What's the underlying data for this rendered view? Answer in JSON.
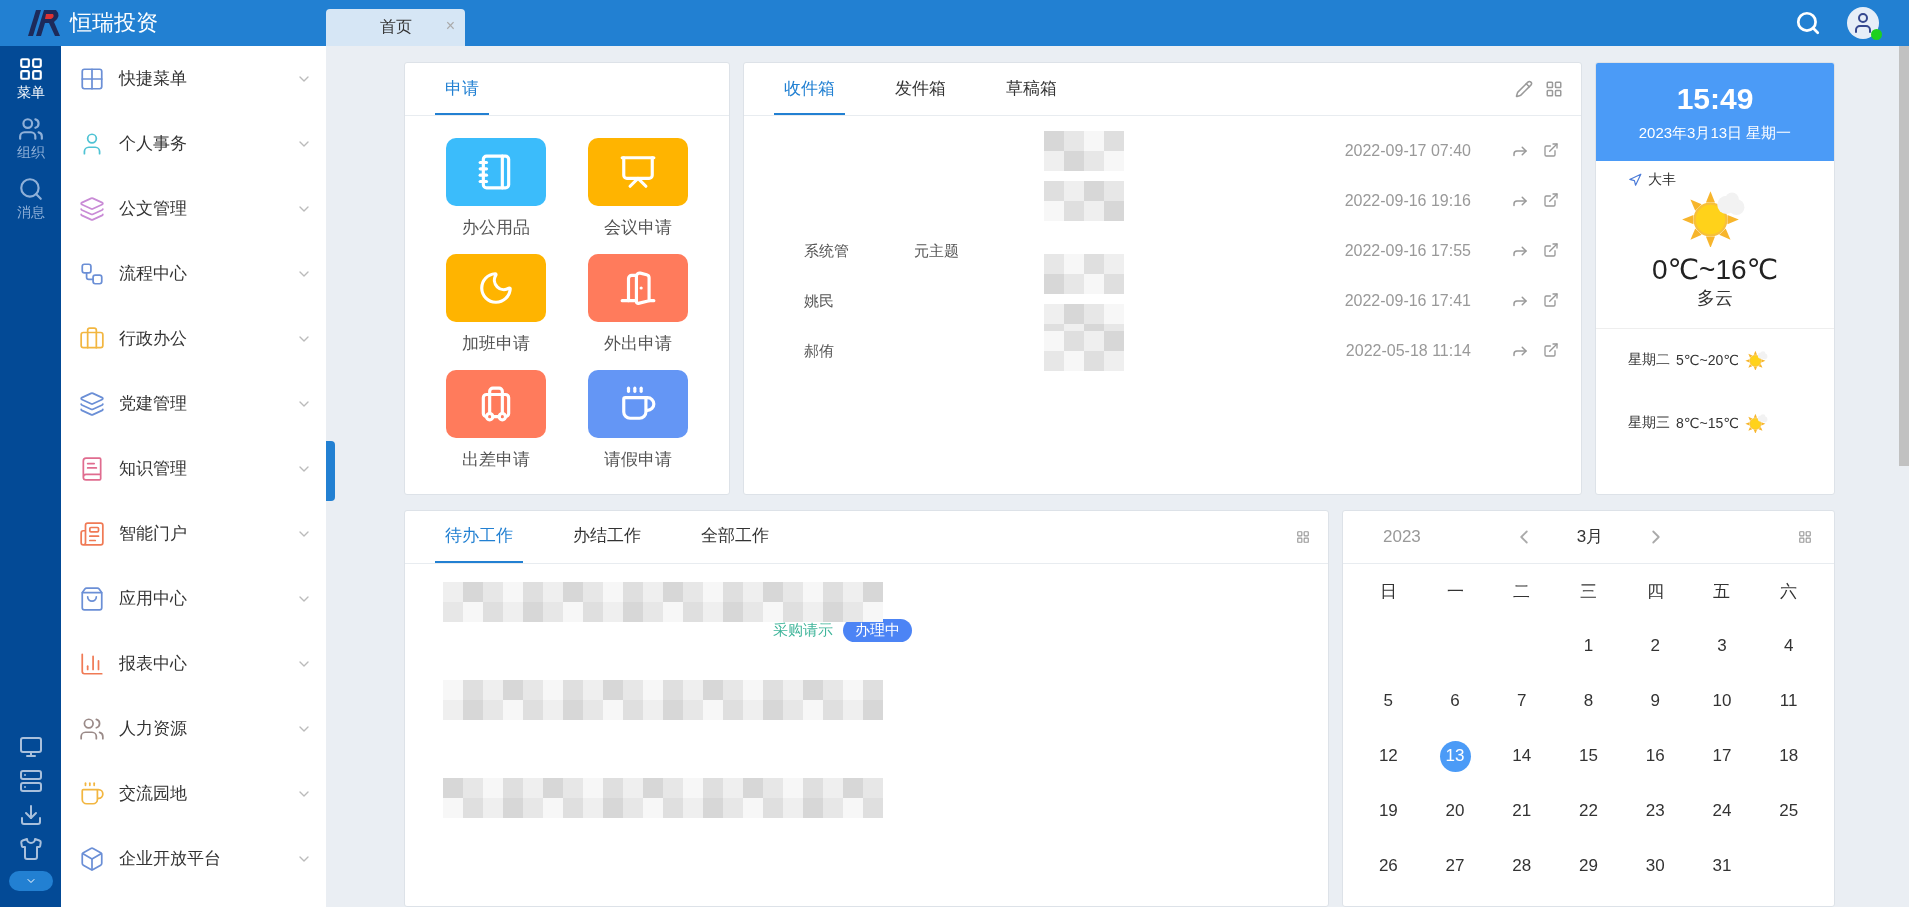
{
  "header": {
    "brand": "恒瑞投资"
  },
  "tabs": [
    {
      "label": "首页",
      "close": "×",
      "selected": true
    }
  ],
  "rail": [
    {
      "label": "菜单",
      "selected": true
    },
    {
      "label": "组织",
      "selected": false
    },
    {
      "label": "消息",
      "selected": false
    }
  ],
  "sidebar": [
    {
      "label": "快捷菜单",
      "color": "#6b8fd6"
    },
    {
      "label": "个人事务",
      "color": "#4fc3d4"
    },
    {
      "label": "公文管理",
      "color": "#c98bd6"
    },
    {
      "label": "流程中心",
      "color": "#6b8fd6"
    },
    {
      "label": "行政办公",
      "color": "#f2b640"
    },
    {
      "label": "党建管理",
      "color": "#6b8fd6"
    },
    {
      "label": "知识管理",
      "color": "#e06c8f"
    },
    {
      "label": "智能门户",
      "color": "#f07a55"
    },
    {
      "label": "应用中心",
      "color": "#6b8fd6"
    },
    {
      "label": "报表中心",
      "color": "#f07a55"
    },
    {
      "label": "人力资源",
      "color": "#9a8a88"
    },
    {
      "label": "交流园地",
      "color": "#f2b640"
    },
    {
      "label": "企业开放平台",
      "color": "#6b8fd6"
    }
  ],
  "apply": {
    "tab": "申请",
    "items": [
      {
        "label": "办公用品",
        "color": "#3bbcfb"
      },
      {
        "label": "会议申请",
        "color": "#ffb400"
      },
      {
        "label": "加班申请",
        "color": "#ffb400"
      },
      {
        "label": "外出申请",
        "color": "#ff7b5c"
      },
      {
        "label": "出差申请",
        "color": "#ff7b5c"
      },
      {
        "label": "请假申请",
        "color": "#6496f5"
      }
    ]
  },
  "mail": {
    "tabs": [
      {
        "label": "收件箱",
        "selected": true
      },
      {
        "label": "发件箱",
        "selected": false
      },
      {
        "label": "草稿箱",
        "selected": false
      }
    ],
    "rows": [
      {
        "time": "2022-09-17 07:40",
        "redacted": true
      },
      {
        "time": "2022-09-16 19:16",
        "redacted": true
      },
      {
        "sender": "系统管",
        "subject": "元主题",
        "time": "2022-09-16 17:55",
        "redacted": true
      },
      {
        "sender": "姚民",
        "time": "2022-09-16 17:41",
        "redacted": true
      },
      {
        "sender": "郝侑",
        "time": "2022-05-18 11:14",
        "redacted": true
      }
    ]
  },
  "clock": {
    "time": "15:49",
    "date": "2023年3月13日  星期一"
  },
  "weather": {
    "location": "大丰",
    "temp": "0℃~16℃",
    "desc": "多云",
    "forecast": [
      {
        "day": "星期二",
        "temp": "5℃~20℃"
      },
      {
        "day": "星期三",
        "temp": "8℃~15℃"
      }
    ]
  },
  "tasks": {
    "tabs": [
      {
        "label": "待办工作",
        "selected": true
      },
      {
        "label": "办结工作",
        "selected": false
      },
      {
        "label": "全部工作",
        "selected": false
      }
    ],
    "rows": [
      {
        "note": "采购请示",
        "status": "办理中",
        "redacted": true
      },
      {
        "redacted": true
      },
      {
        "redacted": true
      }
    ]
  },
  "calendar": {
    "year": "2023",
    "month": "3月",
    "weekdays": [
      "日",
      "一",
      "二",
      "三",
      "四",
      "五",
      "六"
    ],
    "weeks": [
      {
        "starts_mid_week": true,
        "days": [
          {
            "d": "1",
            "selected": false
          },
          {
            "d": "2",
            "selected": false
          },
          {
            "d": "3",
            "selected": false
          },
          {
            "d": "4",
            "selected": false
          }
        ]
      },
      {
        "days": [
          {
            "d": "5",
            "selected": false
          },
          {
            "d": "6",
            "selected": false
          },
          {
            "d": "7",
            "selected": false
          },
          {
            "d": "8",
            "selected": false
          },
          {
            "d": "9",
            "selected": false
          },
          {
            "d": "10",
            "selected": false
          },
          {
            "d": "11",
            "selected": false
          }
        ]
      },
      {
        "days": [
          {
            "d": "12",
            "selected": false
          },
          {
            "d": "13",
            "selected": true
          },
          {
            "d": "14",
            "selected": false
          },
          {
            "d": "15",
            "selected": false
          },
          {
            "d": "16",
            "selected": false
          },
          {
            "d": "17",
            "selected": false
          },
          {
            "d": "18",
            "selected": false
          }
        ]
      },
      {
        "days": [
          {
            "d": "19",
            "selected": false
          },
          {
            "d": "20",
            "selected": false
          },
          {
            "d": "21",
            "selected": false
          },
          {
            "d": "22",
            "selected": false
          },
          {
            "d": "23",
            "selected": false
          },
          {
            "d": "24",
            "selected": false
          },
          {
            "d": "25",
            "selected": false
          }
        ]
      },
      {
        "starts_mid_week": false,
        "days": [
          {
            "d": "26",
            "selected": false
          },
          {
            "d": "27",
            "selected": false
          },
          {
            "d": "28",
            "selected": false
          },
          {
            "d": "29",
            "selected": false
          },
          {
            "d": "30",
            "selected": false
          },
          {
            "d": "31",
            "selected": false
          }
        ]
      }
    ]
  }
}
